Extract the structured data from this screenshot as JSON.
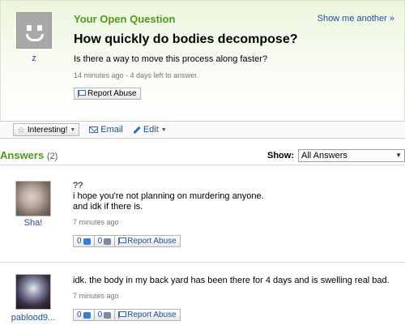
{
  "question": {
    "heading": "Your Open Question",
    "show_another": "Show me another »",
    "user": "z",
    "title": "How quickly do bodies decompose?",
    "body": "Is there a way to move this process along faster?",
    "meta": "14 minutes ago - 4 days left to answer.",
    "report_label": "Report Abuse"
  },
  "actions": {
    "interesting": "Interesting!",
    "email": "Email",
    "edit": "Edit"
  },
  "answers_section": {
    "title": "Answers",
    "count": "(2)",
    "show_label": "Show:",
    "show_value": "All Answers"
  },
  "answers": [
    {
      "user": "Sha!",
      "text": "??\ni hope you're not planning on murdering anyone.\nand idk if there is.",
      "time": "7 minutes ago",
      "thumbs_up": "0",
      "thumbs_down": "0",
      "report_label": "Report Abuse"
    },
    {
      "user": "pablood9...",
      "text": "idk. the body in my back yard has been there for 4 days and is swelling real bad.",
      "time": "7 minutes ago",
      "thumbs_up": "0",
      "thumbs_down": "0",
      "report_label": "Report Abuse"
    }
  ],
  "colors": {
    "accent_green": "#4f9b18",
    "link_blue": "#1d4ea0"
  }
}
